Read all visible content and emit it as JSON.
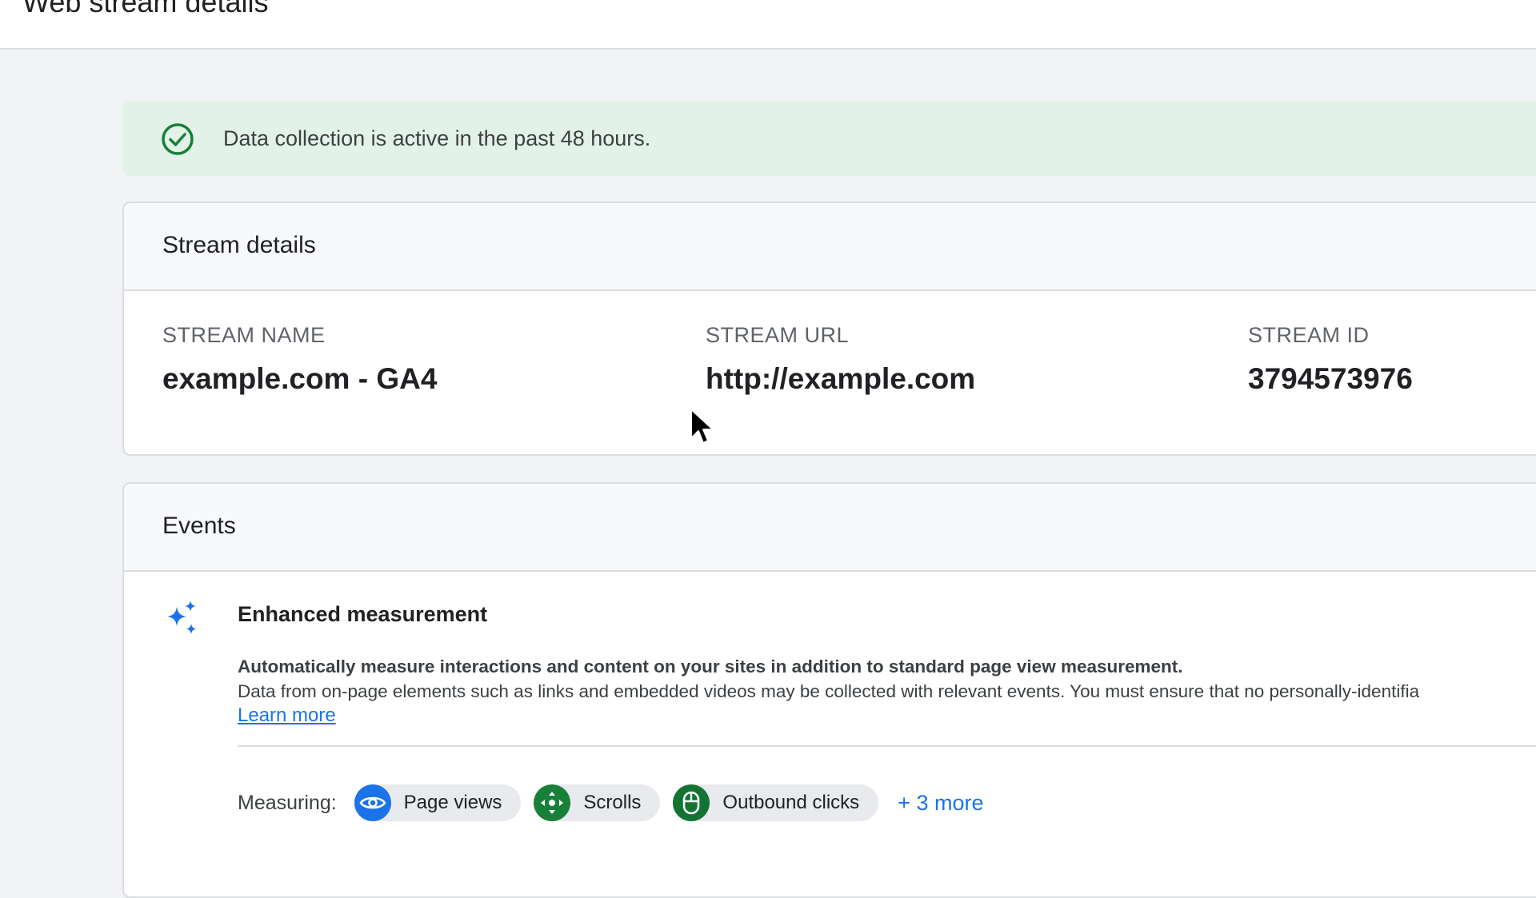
{
  "header": {
    "title": "Web stream details"
  },
  "banner": {
    "text": "Data collection is active in the past 48 hours.",
    "icon": "check-circle-icon",
    "color": "#188038"
  },
  "stream_details": {
    "title": "Stream details",
    "fields": [
      {
        "label": "STREAM NAME",
        "value": "example.com - GA4"
      },
      {
        "label": "STREAM URL",
        "value": "http://example.com"
      },
      {
        "label": "STREAM ID",
        "value": "3794573976"
      }
    ]
  },
  "events": {
    "title": "Events",
    "enhanced_measurement": {
      "title": "Enhanced measurement",
      "icon": "sparkle-icon",
      "description_bold": "Automatically measure interactions and content on your sites in addition to standard page view measurement.",
      "description": "Data from on-page elements such as links and embedded videos may be collected with relevant events. You must ensure that no personally-identifia",
      "learn_more": "Learn more",
      "measuring_label": "Measuring:",
      "chips": [
        {
          "label": "Page views",
          "icon": "eye-icon",
          "color": "#1a73e8"
        },
        {
          "label": "Scrolls",
          "icon": "scroll-arrows-icon",
          "color": "#188038"
        },
        {
          "label": "Outbound clicks",
          "icon": "mouse-icon",
          "color": "#137333"
        }
      ],
      "more": "+ 3 more"
    }
  },
  "colors": {
    "accent": "#1a73e8",
    "success": "#188038"
  }
}
